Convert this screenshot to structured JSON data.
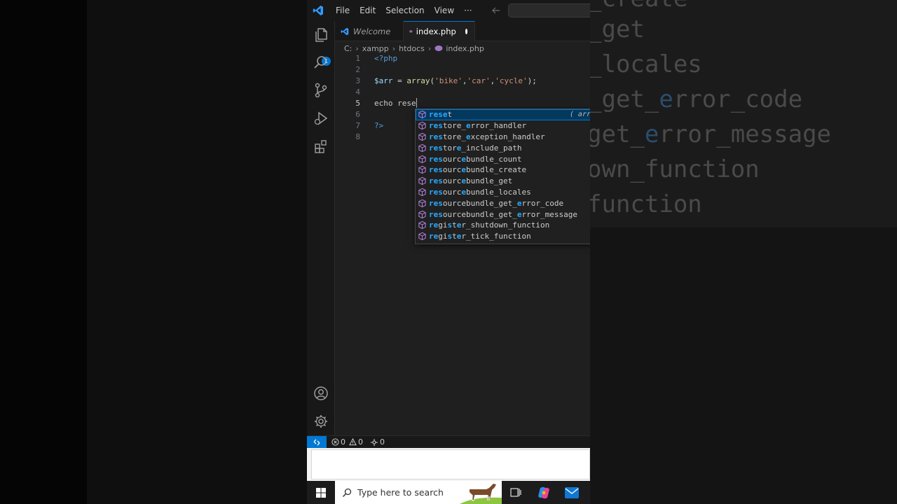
{
  "background": {
    "ghost_lines": [
      {
        "pre": "_create",
        "hl": "",
        "post": ""
      },
      {
        "pre": "_get",
        "hl": "",
        "post": ""
      },
      {
        "pre": "_locales",
        "hl": "",
        "post": ""
      },
      {
        "pre": "_get_",
        "hl": "e",
        "post": "rror_code"
      },
      {
        "pre": "get_",
        "hl": "e",
        "post": "rror_message"
      },
      {
        "pre": "own_function",
        "hl": "",
        "post": ""
      },
      {
        "pre": "function",
        "hl": "",
        "post": ""
      }
    ]
  },
  "titlebar": {
    "menu": [
      "File",
      "Edit",
      "Selection",
      "View",
      "···"
    ]
  },
  "activity_bar": {
    "explorer_badge": "1",
    "icons": [
      "files-icon",
      "search-icon",
      "source-control-icon",
      "run-debug-icon",
      "extensions-icon",
      "account-icon",
      "gear-icon"
    ]
  },
  "tabs": [
    {
      "label": "Welcome",
      "active": false
    },
    {
      "label": "index.php",
      "active": true,
      "dirty": true
    }
  ],
  "breadcrumb": [
    "C:",
    "xampp",
    "htdocs",
    "index.php"
  ],
  "editor": {
    "current_line": 5,
    "lines": [
      {
        "n": "1"
      },
      {
        "n": "2"
      },
      {
        "n": "3"
      },
      {
        "n": "4"
      },
      {
        "n": "5"
      },
      {
        "n": "6"
      },
      {
        "n": "7"
      },
      {
        "n": "8"
      }
    ],
    "code": {
      "open_tag": "<?php",
      "var": "$arr",
      "eq": " = ",
      "fn": "array",
      "open_paren": "(",
      "s1": "'bike'",
      "comma1": ",",
      "s2": "'car'",
      "comma2": ",",
      "s3": "'cycle'",
      "close": ");",
      "echo_text": "echo rese",
      "close_tag": "?>"
    }
  },
  "suggestions": {
    "selected_detail": "( arr",
    "items": [
      {
        "parts": [
          [
            "m",
            "rese"
          ],
          [
            "t",
            "t"
          ]
        ]
      },
      {
        "parts": [
          [
            "m",
            "res"
          ],
          [
            "t",
            "tore_"
          ],
          [
            "m",
            "e"
          ],
          [
            "t",
            "rror_handler"
          ]
        ]
      },
      {
        "parts": [
          [
            "m",
            "res"
          ],
          [
            "t",
            "tore_"
          ],
          [
            "m",
            "e"
          ],
          [
            "t",
            "xception_handler"
          ]
        ]
      },
      {
        "parts": [
          [
            "m",
            "res"
          ],
          [
            "t",
            "tor"
          ],
          [
            "m",
            "e"
          ],
          [
            "t",
            "_include_path"
          ]
        ]
      },
      {
        "parts": [
          [
            "m",
            "res"
          ],
          [
            "t",
            "ourc"
          ],
          [
            "m",
            "e"
          ],
          [
            "t",
            "bundle_count"
          ]
        ]
      },
      {
        "parts": [
          [
            "m",
            "res"
          ],
          [
            "t",
            "ourc"
          ],
          [
            "m",
            "e"
          ],
          [
            "t",
            "bundle_create"
          ]
        ]
      },
      {
        "parts": [
          [
            "m",
            "res"
          ],
          [
            "t",
            "ourc"
          ],
          [
            "m",
            "e"
          ],
          [
            "t",
            "bundle_get"
          ]
        ]
      },
      {
        "parts": [
          [
            "m",
            "res"
          ],
          [
            "t",
            "ourc"
          ],
          [
            "m",
            "e"
          ],
          [
            "t",
            "bundle_locales"
          ]
        ]
      },
      {
        "parts": [
          [
            "m",
            "res"
          ],
          [
            "t",
            "ourcebundle_get_"
          ],
          [
            "m",
            "e"
          ],
          [
            "t",
            "rror_code"
          ]
        ]
      },
      {
        "parts": [
          [
            "m",
            "res"
          ],
          [
            "t",
            "ourcebundle_get_"
          ],
          [
            "m",
            "e"
          ],
          [
            "t",
            "rror_message"
          ]
        ]
      },
      {
        "parts": [
          [
            "m",
            "re"
          ],
          [
            "t",
            "gi"
          ],
          [
            "m",
            "s"
          ],
          [
            "t",
            "t"
          ],
          [
            "m",
            "e"
          ],
          [
            "t",
            "r_shutdown_function"
          ]
        ]
      },
      {
        "parts": [
          [
            "m",
            "re"
          ],
          [
            "t",
            "gi"
          ],
          [
            "m",
            "s"
          ],
          [
            "t",
            "t"
          ],
          [
            "m",
            "e"
          ],
          [
            "t",
            "r_tick_function"
          ]
        ]
      }
    ]
  },
  "statusbar": {
    "errors": "0",
    "warnings": "0",
    "ports": "0"
  },
  "taskbar": {
    "search_placeholder": "Type here to search"
  },
  "colors": {
    "accent": "#0078d4",
    "match": "#2aaaff",
    "php_icon": "#a074c4"
  }
}
